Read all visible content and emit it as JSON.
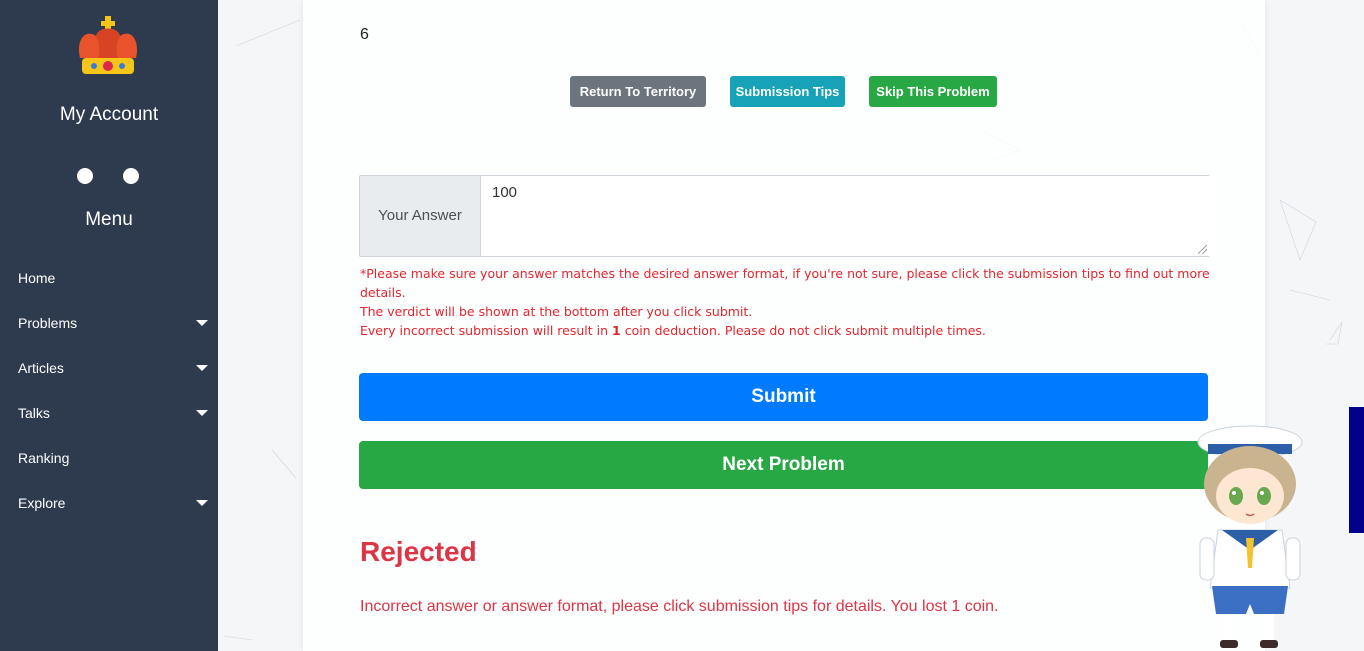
{
  "sidebar": {
    "account_label": "My Account",
    "menu_label": "Menu",
    "items": [
      {
        "label": "Home",
        "has_dropdown": false
      },
      {
        "label": "Problems",
        "has_dropdown": true
      },
      {
        "label": "Articles",
        "has_dropdown": true
      },
      {
        "label": "Talks",
        "has_dropdown": true
      },
      {
        "label": "Ranking",
        "has_dropdown": false
      },
      {
        "label": "Explore",
        "has_dropdown": true
      }
    ]
  },
  "problem": {
    "answer_fragment": "6",
    "buttons": {
      "return": "Return To Territory",
      "tips": "Submission Tips",
      "skip": "Skip This Problem"
    }
  },
  "answer": {
    "label": "Your Answer",
    "value": "100"
  },
  "warning": {
    "line1": "*Please make sure your answer matches the desired answer format, if you're not sure, please click the submission tips to find out more details.",
    "line2": "The verdict will be shown at the bottom after you click submit.",
    "line3_prefix": "Every incorrect submission will result in ",
    "line3_count": "1",
    "line3_suffix": " coin deduction. Please do not click submit multiple times."
  },
  "actions": {
    "submit": "Submit",
    "next": "Next Problem"
  },
  "verdict": {
    "title": "Rejected",
    "message": "Incorrect answer or answer format, please click submission tips for details. You lost 1 coin."
  },
  "colors": {
    "sidebar_bg": "#2e3b4e",
    "submit": "#007bff",
    "next": "#28a745",
    "return_btn": "#6c757d",
    "tips_btn": "#17a2b8",
    "rejected": "#dc3545"
  }
}
